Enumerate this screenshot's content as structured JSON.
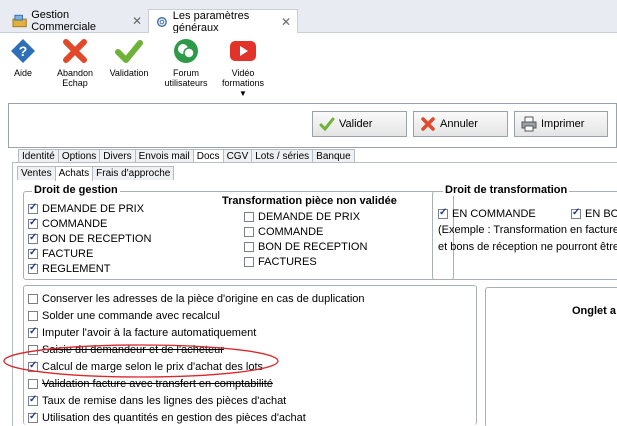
{
  "tabs": [
    {
      "label": "Gestion Commerciale",
      "close": "✕"
    },
    {
      "label": "Les paramètres généraux",
      "close": "✕"
    }
  ],
  "ribbon": [
    {
      "label": "Aide",
      "icon": "help-icon"
    },
    {
      "label": "Abandon Echap",
      "icon": "cancel-x-icon"
    },
    {
      "label": "Validation",
      "icon": "check-icon"
    },
    {
      "label": "Forum utilisateurs",
      "icon": "forum-icon"
    },
    {
      "label": "Vidéo formations",
      "icon": "video-play-icon",
      "arrow": "▼"
    }
  ],
  "actions": {
    "validate": "Valider",
    "cancel": "Annuler",
    "print": "Imprimer"
  },
  "main_tabs": [
    "Identité",
    "Options",
    "Divers",
    "Envois mail",
    "Docs",
    "CGV",
    "Lots / séries",
    "Banque"
  ],
  "main_tab_active": "Docs",
  "sub_tabs": [
    "Ventes",
    "Achats",
    "Frais d'approche"
  ],
  "sub_tab_active": "Achats",
  "droit_gestion": {
    "title": "Droit de gestion",
    "items": [
      {
        "label": "DEMANDE DE PRIX",
        "checked": true
      },
      {
        "label": "COMMANDE",
        "checked": true
      },
      {
        "label": "BON DE RECEPTION",
        "checked": true
      },
      {
        "label": "FACTURE",
        "checked": true
      },
      {
        "label": "REGLEMENT",
        "checked": true
      }
    ]
  },
  "transformation": {
    "title": "Transformation pièce non validée",
    "items": [
      {
        "label": "DEMANDE DE PRIX",
        "checked": false
      },
      {
        "label": "COMMANDE",
        "checked": false
      },
      {
        "label": "BON DE RECEPTION",
        "checked": false
      },
      {
        "label": "FACTURES",
        "checked": false
      }
    ]
  },
  "droit_transformation": {
    "title": "Droit de transformation",
    "en_commande": "EN COMMANDE",
    "en_b": "EN BO",
    "example1": "(Exemple : Transformation en facture",
    "example2": "et bons de réception ne pourront être"
  },
  "options": [
    {
      "label": "Conserver les adresses de la pièce d'origine en cas de duplication",
      "checked": false
    },
    {
      "label": "Solder une commande avec recalcul",
      "checked": false
    },
    {
      "label": "Imputer l'avoir à la facture automatiquement",
      "checked": true
    },
    {
      "label": "Saisie du demandeur et de l'acheteur",
      "checked": false
    },
    {
      "label": "Calcul de marge selon le prix d'achat des lots",
      "checked": true
    },
    {
      "label": "Validation facture avec transfert en comptabilité",
      "checked": false
    },
    {
      "label": "Taux de remise dans les lignes des pièces d'achat",
      "checked": true
    },
    {
      "label": "Utilisation des quantités en gestion des pièces d'achat",
      "checked": true
    }
  ],
  "onglet_label": "Onglet a",
  "colors": {
    "accent": "#1a3a8a",
    "highlight_ellipse": "#d9262b"
  }
}
